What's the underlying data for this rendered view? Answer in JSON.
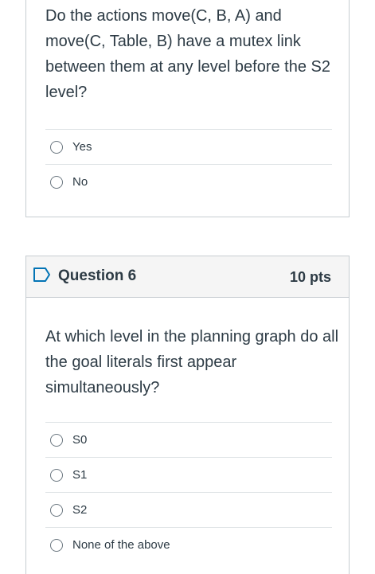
{
  "question5": {
    "text": "Do the actions move(C, B, A) and move(C, Table, B) have a mutex link between them at any level before the S2 level?",
    "answers": [
      "Yes",
      "No"
    ]
  },
  "question6": {
    "title": "Question 6",
    "points": "10 pts",
    "text": "At which level in the planning graph do all the goal literals first appear simultaneously?",
    "answers": [
      "S0",
      "S1",
      "S2",
      "None of the above"
    ]
  },
  "icons": {
    "flag": "flag-outline-icon",
    "radio": "radio-unchecked-icon"
  },
  "colors": {
    "text": "#2d3b45",
    "border": "#c7cdd1",
    "header_bg": "#f5f5f5",
    "flag": "#0374b5"
  }
}
